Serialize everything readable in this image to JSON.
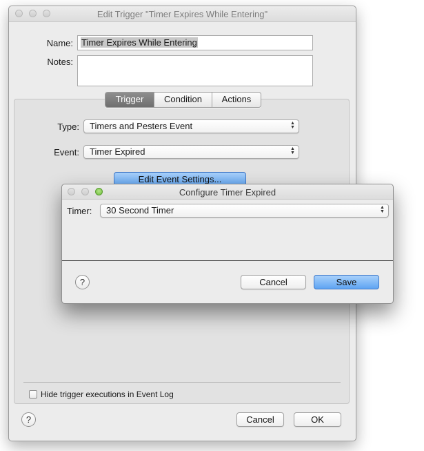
{
  "main_window": {
    "title": "Edit Trigger \"Timer Expires While Entering\"",
    "name_label": "Name:",
    "name_value": "Timer Expires While Entering",
    "notes_label": "Notes:",
    "notes_value": "",
    "tabs": [
      {
        "label": "Trigger",
        "selected": true
      },
      {
        "label": "Condition",
        "selected": false
      },
      {
        "label": "Actions",
        "selected": false
      }
    ],
    "type_label": "Type:",
    "type_value": "Timers and Pesters Event",
    "event_label": "Event:",
    "event_value": "Timer Expired",
    "edit_event_button": "Edit Event Settings...",
    "hide_log_label": "Hide trigger executions in Event Log",
    "hide_log_checked": false,
    "help_label": "?",
    "cancel_label": "Cancel",
    "ok_label": "OK"
  },
  "sheet": {
    "title": "Configure Timer Expired",
    "timer_label": "Timer:",
    "timer_value": "30 Second Timer",
    "help_label": "?",
    "cancel_label": "Cancel",
    "save_label": "Save"
  },
  "colors": {
    "accent_blue": "#5ea4f2",
    "segment_selected": "#7f7f7f",
    "window_bg": "#ececec"
  }
}
